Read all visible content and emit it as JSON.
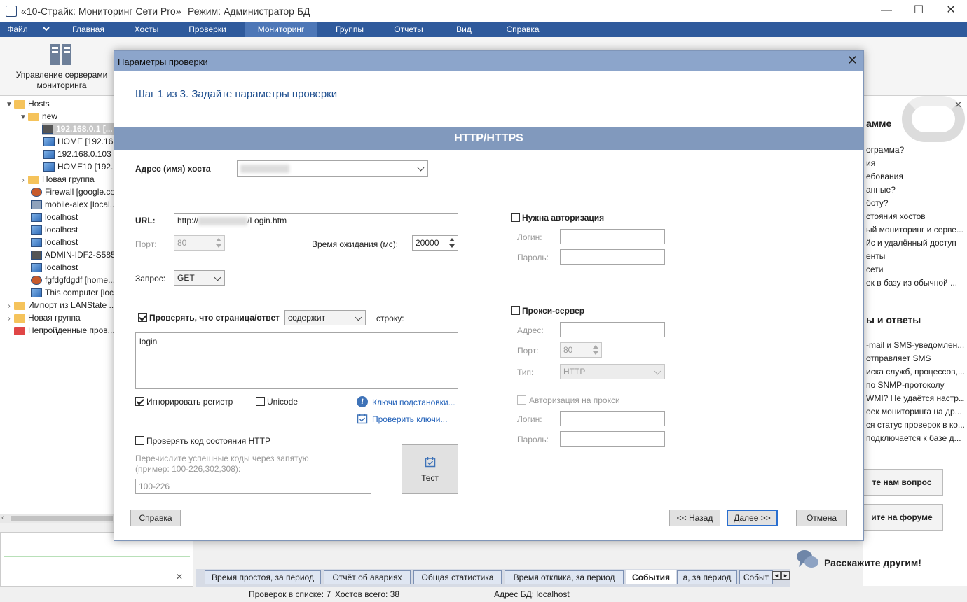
{
  "window": {
    "title": "«10-Страйк: Мониторинг Сети Pro»",
    "mode": "Режим: Администратор БД",
    "min": "—",
    "max": "☐",
    "close": "✕"
  },
  "menu": [
    {
      "label": "Файл"
    },
    {
      "label": "Главная"
    },
    {
      "label": "Хосты"
    },
    {
      "label": "Проверки"
    },
    {
      "label": "Мониторинг"
    },
    {
      "label": "Группы"
    },
    {
      "label": "Отчеты"
    },
    {
      "label": "Вид"
    },
    {
      "label": "Справка"
    }
  ],
  "ribbon": {
    "servers_label_1": "Управление серверами",
    "servers_label_2": "мониторинга"
  },
  "tree": [
    {
      "label": "Hosts"
    },
    {
      "label": "new"
    },
    {
      "label": "192.168.0.1 [..."
    },
    {
      "label": "HOME [192.168..."
    },
    {
      "label": "192.168.0.103"
    },
    {
      "label": "HOME10 [192.1..."
    },
    {
      "label": "Новая группа"
    },
    {
      "label": "Firewall [google.co..."
    },
    {
      "label": "mobile-alex [local..."
    },
    {
      "label": "localhost"
    },
    {
      "label": "localhost"
    },
    {
      "label": "localhost"
    },
    {
      "label": "ADMIN-IDF2-S585..."
    },
    {
      "label": "localhost"
    },
    {
      "label": "fgfdgfdgdf [home..."
    },
    {
      "label": "This computer [loc..."
    },
    {
      "label": "Импорт из LANState ..."
    },
    {
      "label": "Новая группа"
    },
    {
      "label": "Непройденные пров..."
    }
  ],
  "right_panel": {
    "head1": "амме",
    "lines1": [
      "ограмма?",
      "ия",
      "ебования",
      "анные?",
      "боту?",
      "стояния хостов",
      "ый мониторинг и серве...",
      "йс и удалённый доступ",
      "енты",
      "сети",
      "ек в базу из обычной ..."
    ],
    "head2": "ы и ответы",
    "lines2": [
      "-mail и SMS-уведомлен...",
      "отправляет SMS",
      "иска служб, процессов,...",
      "по SNMP-протоколу",
      "WMI? Не удаётся настр...",
      "оек мониторинга на др...",
      "ся статус проверок в ко...",
      "подключается к базе д..."
    ],
    "btn1": "те нам вопрос",
    "btn2": "ите на форуме",
    "share": "Расскажите другим!"
  },
  "bottom_tabs": [
    {
      "label": "Время простоя, за период"
    },
    {
      "label": "Отчёт об авариях"
    },
    {
      "label": "Общая статистика"
    },
    {
      "label": "Время отклика, за период"
    },
    {
      "label": "События"
    },
    {
      "label": "а, за период"
    },
    {
      "label": "Событ"
    }
  ],
  "status": {
    "checks": "Проверок в списке: 7",
    "hosts": "Хостов всего: 38",
    "db": "Адрес БД: localhost"
  },
  "dialog": {
    "title": "Параметры проверки",
    "step": "Шаг 1 из 3. Задайте параметры проверки",
    "section": "HTTP/HTTPS",
    "host_label": "Адрес (имя) хоста",
    "url_label": "URL:",
    "url_prefix": "http://",
    "url_suffix": "/Login.htm",
    "port_label": "Порт:",
    "port_value": "80",
    "timeout_label": "Время ожидания (мс):",
    "timeout_value": "20000",
    "request_label": "Запрос:",
    "request_value": "GET",
    "check_page_label": "Проверять, что страница/ответ",
    "contains_value": "содержит",
    "string_label": "строку:",
    "content_value": "login",
    "ignore_case": "Игнорировать регистр",
    "unicode": "Unicode",
    "keys_link": "Ключи подстановки...",
    "check_keys_link": "Проверить ключи...",
    "check_http_label": "Проверять код состояния HTTP",
    "codes_hint_1": "Перечислите успешные коды через запятую",
    "codes_hint_2": "(пример: 100-226,302,308):",
    "codes_value": "100-226",
    "test_btn": "Тест",
    "auth_label": "Нужна авторизация",
    "login_label": "Логин:",
    "password_label": "Пароль:",
    "proxy_label": "Прокси-сервер",
    "proxy_addr_label": "Адрес:",
    "proxy_port_label": "Порт:",
    "proxy_port_value": "80",
    "proxy_type_label": "Тип:",
    "proxy_type_value": "HTTP",
    "proxy_auth_label": "Авторизация на прокси",
    "proxy_login_label": "Логин:",
    "proxy_password_label": "Пароль:",
    "help_btn": "Справка",
    "back_btn": "<< Назад",
    "next_btn": "Далее >>",
    "cancel_btn": "Отмена",
    "close": "✕"
  }
}
